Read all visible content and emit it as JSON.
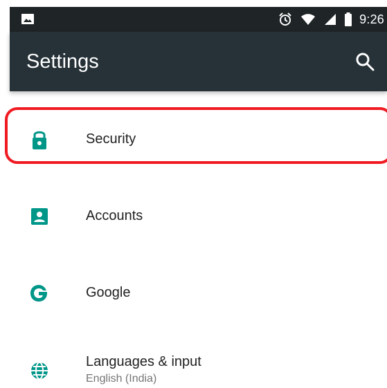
{
  "status_bar": {
    "time": "9:26",
    "icons": [
      "image-icon",
      "alarm-icon",
      "wifi-icon",
      "cell-signal-icon",
      "battery-icon"
    ]
  },
  "app_bar": {
    "title": "Settings",
    "search_icon": "search-icon"
  },
  "colors": {
    "status_bar": "#1f2527",
    "app_bar": "#263238",
    "accent": "#009688",
    "highlight": "#f01b22"
  },
  "settings": {
    "items": [
      {
        "label": "Security",
        "icon": "lock-icon",
        "highlighted": true
      },
      {
        "label": "Accounts",
        "icon": "account-icon"
      },
      {
        "label": "Google",
        "icon": "google-icon"
      },
      {
        "label": "Languages & input",
        "sublabel": "English (India)",
        "icon": "globe-icon"
      }
    ]
  }
}
